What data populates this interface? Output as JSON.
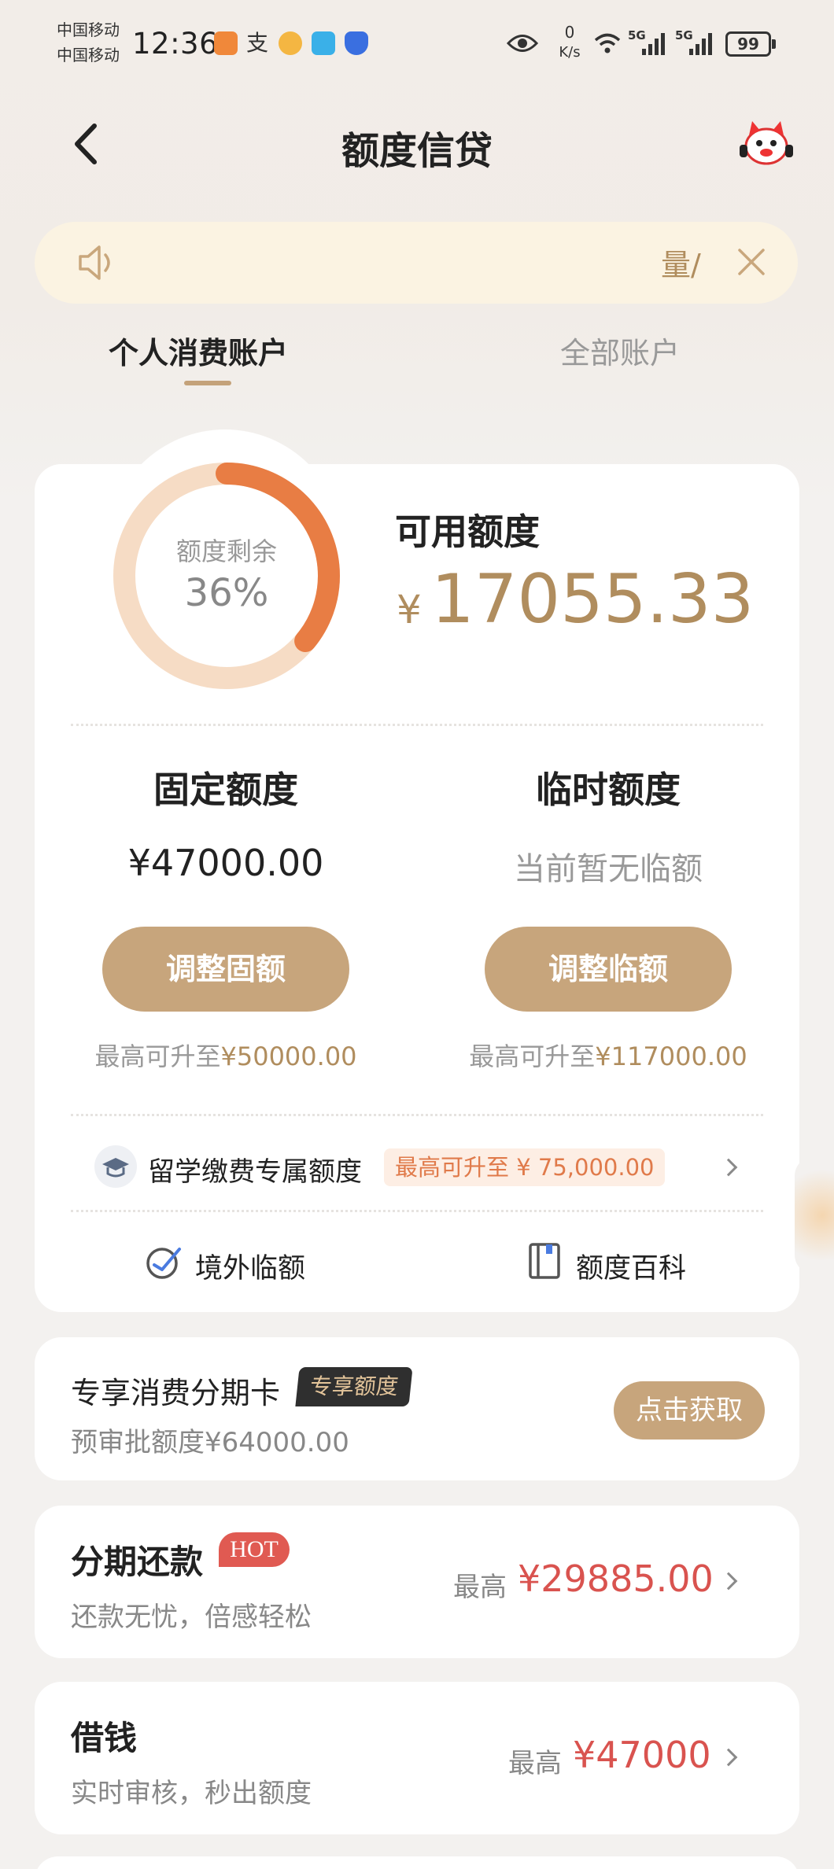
{
  "status_bar": {
    "carrier_1": "中国移动",
    "carrier_2": "中国移动",
    "time": "12:36",
    "net_speed_value": "0",
    "net_speed_unit": "K/s",
    "signal_1": "5G",
    "signal_2": "5G",
    "battery": "99"
  },
  "header": {
    "title": "额度信贷"
  },
  "notice": {
    "text": "量/"
  },
  "tabs": [
    {
      "label": "个人消费账户",
      "active": true
    },
    {
      "label": "全部账户",
      "active": false
    }
  ],
  "credit": {
    "ring_label": "额度剩余",
    "ring_percent": "36%",
    "remaining_fraction": 0.36,
    "available_label": "可用额度",
    "available_currency": "¥",
    "available_amount": "17055.33",
    "fixed": {
      "label": "固定额度",
      "value": "¥47000.00",
      "button": "调整固额",
      "max_prefix": "最高可升至",
      "max_value": "¥50000.00"
    },
    "temp": {
      "label": "临时额度",
      "value": "当前暂无临额",
      "button": "调整临额",
      "max_prefix": "最高可升至",
      "max_value": "¥117000.00"
    },
    "study": {
      "label": "留学缴费专属额度",
      "tag": "最高可升至 ¥ 75,000.00"
    },
    "links": {
      "overseas": "境外临额",
      "wiki": "额度百科"
    }
  },
  "installment_card": {
    "title": "专享消费分期卡",
    "badge": "专享额度",
    "sub": "预审批额度¥64000.00",
    "button": "点击获取"
  },
  "installment_repay": {
    "title": "分期还款",
    "badge": "HOT",
    "sub": "还款无忧，倍感轻松",
    "prefix": "最高",
    "amount": "¥29885.00"
  },
  "borrow": {
    "title": "借钱",
    "sub": "实时审核，秒出额度",
    "prefix": "最高",
    "amount": "¥47000"
  },
  "colors": {
    "accent_gold": "#c7a57c",
    "ring_orange": "#e87d44",
    "ring_track": "#f6dcc5",
    "amount_red": "#d9534f"
  }
}
